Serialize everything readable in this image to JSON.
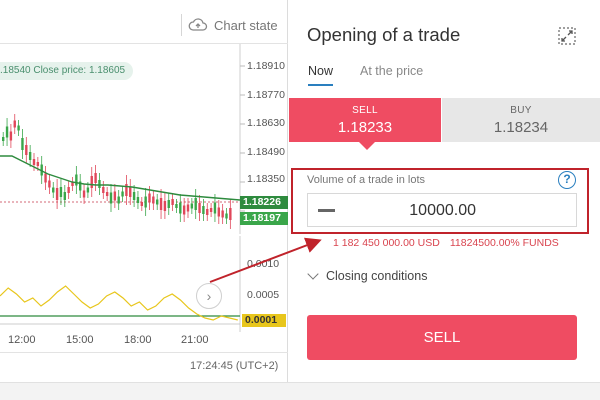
{
  "chart": {
    "toolbar": {
      "chart_state_label": "Chart state"
    },
    "price_info": ".18540 Close price: 1.18605",
    "price_ticks": [
      "1.18910",
      "1.18770",
      "1.18630",
      "1.18490",
      "1.18350"
    ],
    "price_badges": {
      "current_high": "1.18226",
      "current_low": "1.18197"
    },
    "indicator_ticks": [
      "0.0010",
      "0.0005"
    ],
    "indicator_badge": "0.0001",
    "time_ticks": [
      "12:00",
      "15:00",
      "18:00",
      "21:00"
    ],
    "clock": "17:24:45 (UTC+2)",
    "colors": {
      "bull": "#3aa64a",
      "bear": "#e0475a",
      "ma": "#2e8b3e",
      "indicator": "#e8c61c"
    }
  },
  "trade": {
    "title": "Opening of a trade",
    "tabs": {
      "now": "Now",
      "at_price": "At the price"
    },
    "sell": {
      "label": "SELL",
      "price": "1.18233"
    },
    "buy": {
      "label": "BUY",
      "price": "1.18234"
    },
    "volume": {
      "label": "Volume of a trade in lots",
      "value": "10000.00",
      "help": "?"
    },
    "funds": {
      "usd": "1 182 450 000.00 USD",
      "percent": "11824500.00% FUNDS"
    },
    "closing_conditions": "Closing conditions",
    "sell_button": "SELL",
    "colors": {
      "sell": "#ef4c62",
      "buy_bg": "#e7e7e7",
      "highlight": "#c0232b",
      "accent": "#2a7fbf"
    }
  }
}
